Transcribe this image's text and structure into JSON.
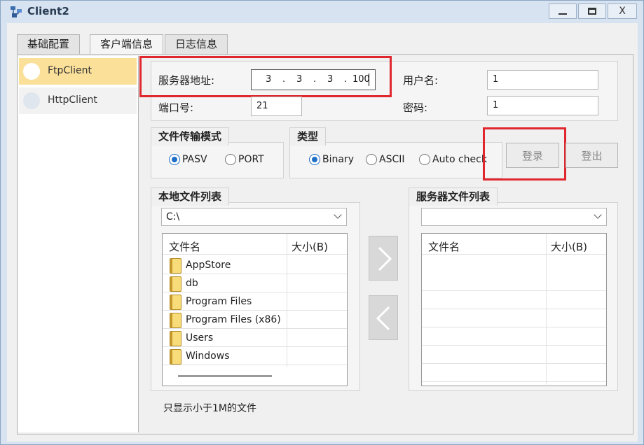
{
  "window": {
    "title": "Client2",
    "close_label": "X"
  },
  "tabs": [
    {
      "label": "基础配置"
    },
    {
      "label": "客户端信息"
    },
    {
      "label": "日志信息"
    }
  ],
  "sidebar": {
    "items": [
      {
        "label": "FtpClient",
        "selected": true
      },
      {
        "label": "HttpClient",
        "selected": false
      }
    ]
  },
  "connection": {
    "server_label": "服务器地址:",
    "ip": [
      "3",
      "3",
      "3",
      "100"
    ],
    "ip_dots": ".",
    "user_label": "用户名:",
    "user_value": "1",
    "port_label": "端口号:",
    "port_value": "21",
    "password_label": "密码:",
    "password_value": "1"
  },
  "transfer_mode": {
    "title": "文件传输模式",
    "options": [
      {
        "label": "PASV",
        "checked": true
      },
      {
        "label": "PORT",
        "checked": false
      }
    ]
  },
  "type": {
    "title": "类型",
    "options": [
      {
        "label": "Binary",
        "checked": true
      },
      {
        "label": "ASCII",
        "checked": false
      },
      {
        "label": "Auto check",
        "checked": false
      }
    ]
  },
  "buttons": {
    "login": "登录",
    "logout": "登出"
  },
  "local_files": {
    "title": "本地文件列表",
    "path": "C:\\",
    "columns": [
      "文件名",
      "大小(B)"
    ],
    "items": [
      "AppStore",
      "db",
      "Program Files",
      "Program Files (x86)",
      "Users",
      "Windows"
    ]
  },
  "server_files": {
    "title": "服务器文件列表",
    "path": "",
    "columns": [
      "文件名",
      "大小(B)"
    ]
  },
  "footer_note": "只显示小于1M的文件",
  "colors": {
    "highlight_frame": "#e0272d",
    "selected_item": "#fbe09a",
    "radio_on": "#1f6fc7"
  }
}
